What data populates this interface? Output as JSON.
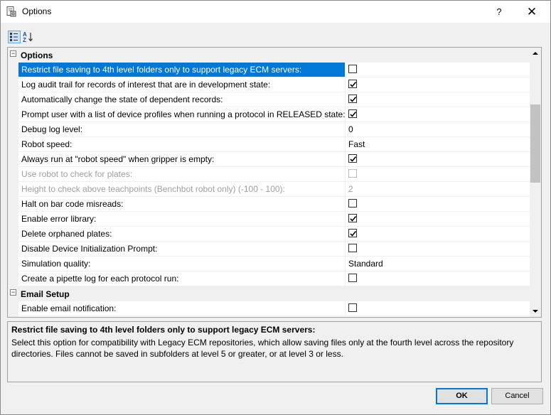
{
  "window": {
    "title": "Options",
    "help_label": "?",
    "close_label": "✕"
  },
  "toolbar": {
    "categorized_icon": "categorized-view-icon",
    "alphabetical_icon": "alphabetical-sort-icon"
  },
  "categories": [
    {
      "label": "Options",
      "expanded": true,
      "rows": [
        {
          "name": "Restrict file saving to 4th level folders only to support legacy ECM servers:",
          "type": "checkbox",
          "checked": false,
          "selected": true,
          "disabled": false
        },
        {
          "name": "Log audit trail for records of interest that are in development state:",
          "type": "checkbox",
          "checked": true,
          "selected": false,
          "disabled": false
        },
        {
          "name": "Automatically change the state of dependent records:",
          "type": "checkbox",
          "checked": true,
          "selected": false,
          "disabled": false
        },
        {
          "name": "Prompt user with a list of device profiles when running a protocol in RELEASED state:",
          "type": "checkbox",
          "checked": true,
          "selected": false,
          "disabled": false
        },
        {
          "name": "Debug log level:",
          "type": "text",
          "value": "0",
          "selected": false,
          "disabled": false
        },
        {
          "name": "Robot speed:",
          "type": "text",
          "value": "Fast",
          "selected": false,
          "disabled": false
        },
        {
          "name": "Always run at \"robot speed\" when gripper is empty:",
          "type": "checkbox",
          "checked": true,
          "selected": false,
          "disabled": false
        },
        {
          "name": "Use robot to check for plates:",
          "type": "checkbox",
          "checked": false,
          "selected": false,
          "disabled": true
        },
        {
          "name": "Height to check above teachpoints (Benchbot robot only) (-100 - 100):",
          "type": "text",
          "value": "2",
          "selected": false,
          "disabled": true
        },
        {
          "name": "Halt on bar code misreads:",
          "type": "checkbox",
          "checked": false,
          "selected": false,
          "disabled": false
        },
        {
          "name": "Enable error library:",
          "type": "checkbox",
          "checked": true,
          "selected": false,
          "disabled": false
        },
        {
          "name": "Delete orphaned plates:",
          "type": "checkbox",
          "checked": true,
          "selected": false,
          "disabled": false
        },
        {
          "name": "Disable Device Initialization Prompt:",
          "type": "checkbox",
          "checked": false,
          "selected": false,
          "disabled": false
        },
        {
          "name": "Simulation quality:",
          "type": "text",
          "value": "Standard",
          "selected": false,
          "disabled": false
        },
        {
          "name": "Create a pipette log for each protocol run:",
          "type": "checkbox",
          "checked": false,
          "selected": false,
          "disabled": false
        }
      ]
    },
    {
      "label": "Email Setup",
      "expanded": true,
      "rows": [
        {
          "name": "Enable email notification:",
          "type": "checkbox",
          "checked": false,
          "selected": false,
          "disabled": false
        }
      ]
    }
  ],
  "description": {
    "title": "Restrict file saving to 4th level folders only to support legacy ECM servers:",
    "text": "Select this option for compatibility with Legacy ECM repositories, which allow saving files only at the fourth level across the repository directories.  Files cannot be saved in subfolders at level 5 or greater, or at level 3 or less."
  },
  "buttons": {
    "ok_label": "OK",
    "cancel_label": "Cancel"
  },
  "colors": {
    "selection": "#0078d7",
    "disabled_text": "#a0a0a0",
    "panel_bg": "#f0f0f0"
  }
}
